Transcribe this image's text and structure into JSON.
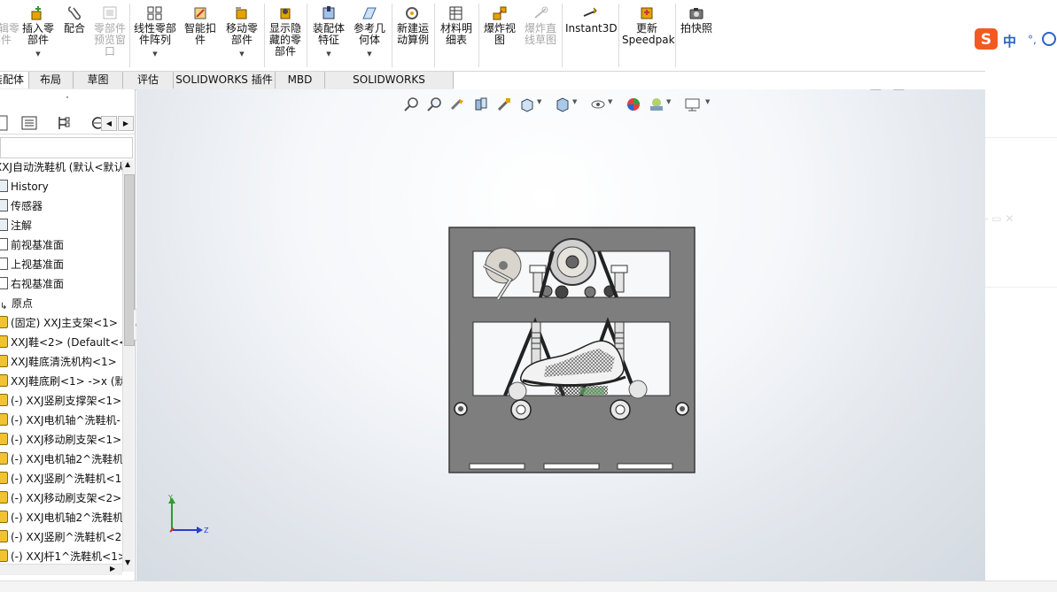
{
  "ribbon": {
    "buttons": [
      {
        "label": "插入零\n部件",
        "disabled": false,
        "icon": "insert-components-icon"
      },
      {
        "label": "配合",
        "disabled": false,
        "icon": "mate-icon"
      },
      {
        "label": "零部件\n预览窗\n口",
        "disabled": true,
        "icon": "component-preview-icon"
      },
      {
        "label": "线性零部\n件阵列",
        "disabled": false,
        "icon": "linear-pattern-icon"
      },
      {
        "label": "智能扣\n件",
        "disabled": false,
        "icon": "smart-fasteners-icon"
      },
      {
        "label": "移动零\n部件",
        "disabled": false,
        "icon": "move-component-icon"
      },
      {
        "label": "显示隐\n藏的零\n部件",
        "disabled": false,
        "icon": "show-hidden-icon"
      },
      {
        "label": "装配体\n特征",
        "disabled": false,
        "icon": "assembly-features-icon"
      },
      {
        "label": "参考几\n何体",
        "disabled": false,
        "icon": "reference-geometry-icon"
      },
      {
        "label": "新建运\n动算例",
        "disabled": false,
        "icon": "new-motion-study-icon"
      },
      {
        "label": "材料明\n细表",
        "disabled": false,
        "icon": "bom-icon"
      },
      {
        "label": "爆炸视\n图",
        "disabled": false,
        "icon": "exploded-view-icon"
      },
      {
        "label": "爆炸直\n线草图",
        "disabled": true,
        "icon": "explode-line-sketch-icon"
      },
      {
        "label": "Instant3D",
        "disabled": false,
        "icon": "instant3d-icon"
      },
      {
        "label": "更新\nSpeedpak",
        "disabled": false,
        "icon": "speedpak-icon"
      },
      {
        "label": "拍快照",
        "disabled": false,
        "icon": "snapshot-icon"
      }
    ],
    "cut_left": "编辑零\n部件"
  },
  "tabs": [
    "装配体",
    "布局",
    "草图",
    "评估",
    "SOLIDWORKS 插件",
    "MBD",
    "SOLIDWORKS Inspection"
  ],
  "ime": {
    "label": "中"
  },
  "tree": {
    "root": "XXJ自动洗鞋机  (默认<默认",
    "items": [
      "History",
      "传感器",
      "注解",
      "前视基准面",
      "上视基准面",
      "右视基准面",
      "原点",
      "(固定) XXJ主支架<1>",
      "XXJ鞋<2> (Default<<",
      "XXJ鞋底清洗机构<1>",
      "XXJ鞋底刷<1> ->x (默",
      "(-) XXJ竖刷支撑架<1>",
      "(-) XXJ电机轴^洗鞋机-",
      "(-) XXJ移动刷支架<1>",
      "(-) XXJ电机轴2^洗鞋机",
      "(-) XXJ竖刷^洗鞋机<1",
      "(-) XXJ移动刷支架<2>",
      "(-) XXJ电机轴2^洗鞋机",
      "(-) XXJ竖刷^洗鞋机<2",
      "(-) XXJ杆1^洗鞋机<1>"
    ]
  },
  "triad": {
    "y": "Y",
    "z": "Z"
  },
  "colors": {
    "frame": "#7e7e7e",
    "frameEdge": "#3a3a3a",
    "accent": "#3b6fd6"
  }
}
